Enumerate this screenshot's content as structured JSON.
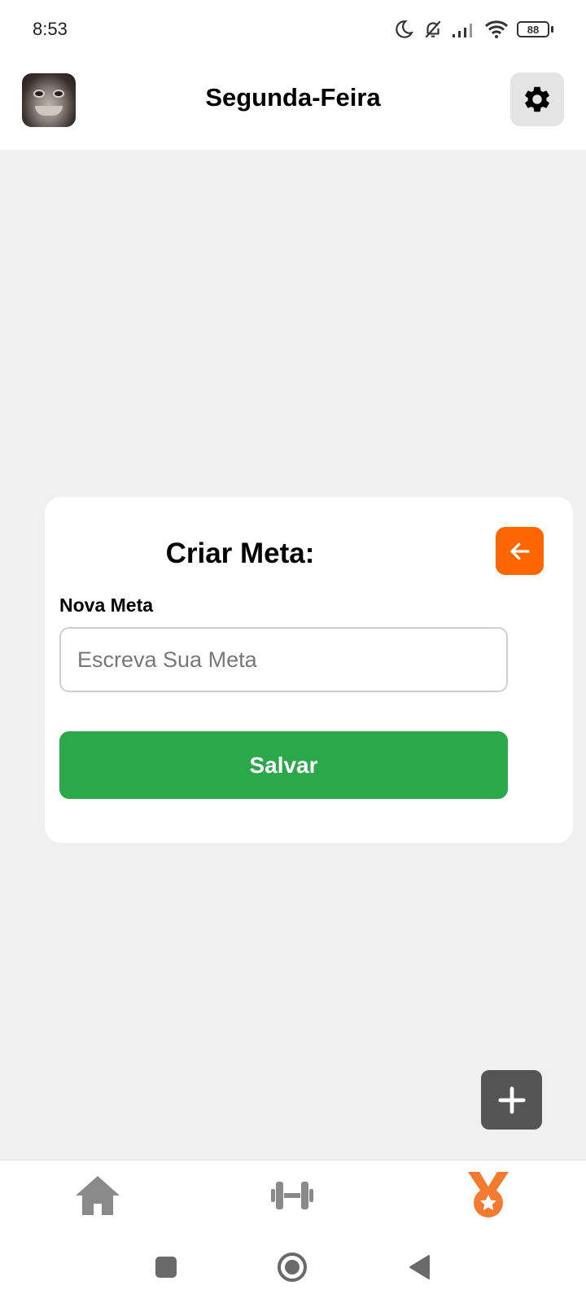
{
  "status_bar": {
    "time": "8:53",
    "battery_level": "88",
    "icons": [
      "moon-icon",
      "bell-off-icon",
      "signal-icon",
      "wifi-icon",
      "battery-icon"
    ]
  },
  "header": {
    "title": "Segunda-Feira",
    "avatar_icon": "frog-avatar",
    "settings_icon": "gear-icon"
  },
  "create_goal": {
    "title": "Criar Meta:",
    "back_icon": "arrow-left-icon",
    "field_label": "Nova Meta",
    "input_value": "",
    "input_placeholder": "Escreva Sua Meta",
    "save_label": "Salvar"
  },
  "fab": {
    "icon": "plus-icon"
  },
  "bottom_nav": {
    "items": [
      {
        "icon": "home-icon",
        "active": false
      },
      {
        "icon": "dumbbell-icon",
        "active": false
      },
      {
        "icon": "medal-icon",
        "active": true
      }
    ]
  },
  "system_nav": {
    "items": [
      "square-recent-icon",
      "circle-home-icon",
      "triangle-back-icon"
    ]
  },
  "colors": {
    "accent_orange": "#ff6600",
    "save_green": "#2aa84a",
    "fab_gray": "#555555",
    "nav_inactive": "#8a8a8a",
    "background": "#f0f0f0"
  }
}
